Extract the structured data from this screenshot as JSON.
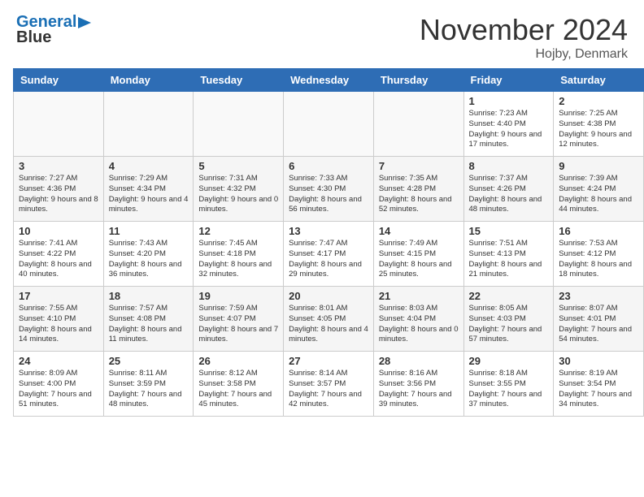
{
  "logo": {
    "line1": "General",
    "line2": "Blue"
  },
  "title": "November 2024",
  "location": "Hojby, Denmark",
  "weekdays": [
    "Sunday",
    "Monday",
    "Tuesday",
    "Wednesday",
    "Thursday",
    "Friday",
    "Saturday"
  ],
  "weeks": [
    [
      {
        "day": "",
        "info": ""
      },
      {
        "day": "",
        "info": ""
      },
      {
        "day": "",
        "info": ""
      },
      {
        "day": "",
        "info": ""
      },
      {
        "day": "",
        "info": ""
      },
      {
        "day": "1",
        "info": "Sunrise: 7:23 AM\nSunset: 4:40 PM\nDaylight: 9 hours and 17 minutes."
      },
      {
        "day": "2",
        "info": "Sunrise: 7:25 AM\nSunset: 4:38 PM\nDaylight: 9 hours and 12 minutes."
      }
    ],
    [
      {
        "day": "3",
        "info": "Sunrise: 7:27 AM\nSunset: 4:36 PM\nDaylight: 9 hours and 8 minutes."
      },
      {
        "day": "4",
        "info": "Sunrise: 7:29 AM\nSunset: 4:34 PM\nDaylight: 9 hours and 4 minutes."
      },
      {
        "day": "5",
        "info": "Sunrise: 7:31 AM\nSunset: 4:32 PM\nDaylight: 9 hours and 0 minutes."
      },
      {
        "day": "6",
        "info": "Sunrise: 7:33 AM\nSunset: 4:30 PM\nDaylight: 8 hours and 56 minutes."
      },
      {
        "day": "7",
        "info": "Sunrise: 7:35 AM\nSunset: 4:28 PM\nDaylight: 8 hours and 52 minutes."
      },
      {
        "day": "8",
        "info": "Sunrise: 7:37 AM\nSunset: 4:26 PM\nDaylight: 8 hours and 48 minutes."
      },
      {
        "day": "9",
        "info": "Sunrise: 7:39 AM\nSunset: 4:24 PM\nDaylight: 8 hours and 44 minutes."
      }
    ],
    [
      {
        "day": "10",
        "info": "Sunrise: 7:41 AM\nSunset: 4:22 PM\nDaylight: 8 hours and 40 minutes."
      },
      {
        "day": "11",
        "info": "Sunrise: 7:43 AM\nSunset: 4:20 PM\nDaylight: 8 hours and 36 minutes."
      },
      {
        "day": "12",
        "info": "Sunrise: 7:45 AM\nSunset: 4:18 PM\nDaylight: 8 hours and 32 minutes."
      },
      {
        "day": "13",
        "info": "Sunrise: 7:47 AM\nSunset: 4:17 PM\nDaylight: 8 hours and 29 minutes."
      },
      {
        "day": "14",
        "info": "Sunrise: 7:49 AM\nSunset: 4:15 PM\nDaylight: 8 hours and 25 minutes."
      },
      {
        "day": "15",
        "info": "Sunrise: 7:51 AM\nSunset: 4:13 PM\nDaylight: 8 hours and 21 minutes."
      },
      {
        "day": "16",
        "info": "Sunrise: 7:53 AM\nSunset: 4:12 PM\nDaylight: 8 hours and 18 minutes."
      }
    ],
    [
      {
        "day": "17",
        "info": "Sunrise: 7:55 AM\nSunset: 4:10 PM\nDaylight: 8 hours and 14 minutes."
      },
      {
        "day": "18",
        "info": "Sunrise: 7:57 AM\nSunset: 4:08 PM\nDaylight: 8 hours and 11 minutes."
      },
      {
        "day": "19",
        "info": "Sunrise: 7:59 AM\nSunset: 4:07 PM\nDaylight: 8 hours and 7 minutes."
      },
      {
        "day": "20",
        "info": "Sunrise: 8:01 AM\nSunset: 4:05 PM\nDaylight: 8 hours and 4 minutes."
      },
      {
        "day": "21",
        "info": "Sunrise: 8:03 AM\nSunset: 4:04 PM\nDaylight: 8 hours and 0 minutes."
      },
      {
        "day": "22",
        "info": "Sunrise: 8:05 AM\nSunset: 4:03 PM\nDaylight: 7 hours and 57 minutes."
      },
      {
        "day": "23",
        "info": "Sunrise: 8:07 AM\nSunset: 4:01 PM\nDaylight: 7 hours and 54 minutes."
      }
    ],
    [
      {
        "day": "24",
        "info": "Sunrise: 8:09 AM\nSunset: 4:00 PM\nDaylight: 7 hours and 51 minutes."
      },
      {
        "day": "25",
        "info": "Sunrise: 8:11 AM\nSunset: 3:59 PM\nDaylight: 7 hours and 48 minutes."
      },
      {
        "day": "26",
        "info": "Sunrise: 8:12 AM\nSunset: 3:58 PM\nDaylight: 7 hours and 45 minutes."
      },
      {
        "day": "27",
        "info": "Sunrise: 8:14 AM\nSunset: 3:57 PM\nDaylight: 7 hours and 42 minutes."
      },
      {
        "day": "28",
        "info": "Sunrise: 8:16 AM\nSunset: 3:56 PM\nDaylight: 7 hours and 39 minutes."
      },
      {
        "day": "29",
        "info": "Sunrise: 8:18 AM\nSunset: 3:55 PM\nDaylight: 7 hours and 37 minutes."
      },
      {
        "day": "30",
        "info": "Sunrise: 8:19 AM\nSunset: 3:54 PM\nDaylight: 7 hours and 34 minutes."
      }
    ]
  ]
}
